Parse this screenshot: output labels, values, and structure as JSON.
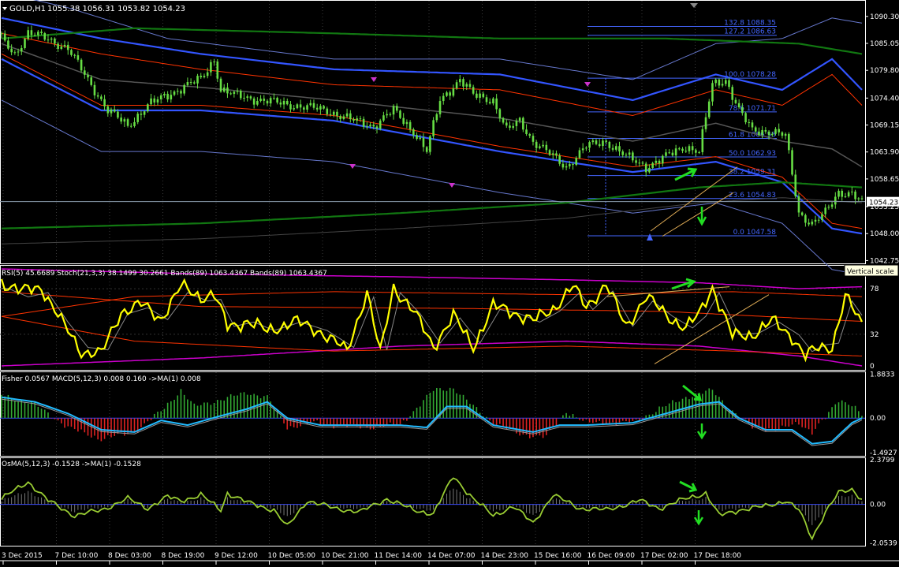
{
  "window": {
    "title": "GOLD,H1",
    "ohlc": "1055.38 1056.31 1053.82 1054.23",
    "vertical_scale_tooltip": "Vertical scale"
  },
  "colors": {
    "background": "#000000",
    "axis": "#ffffff",
    "grid": "#3a3a3a",
    "price": "#66dd44",
    "bollinger_outer": "#3355ff",
    "bollinger_inner": "#6677cc",
    "bands_red": "#ff3300",
    "bands_green": "#117711",
    "fibonacci": "#4466ff",
    "rsi": "#ffff00",
    "stoch": "#888888",
    "stoch_bands": "#cc00cc",
    "stoch_red": "#ff3300",
    "fisher_pos": "#33aa33",
    "fisher_neg": "#dd2222",
    "macd": "#22bbff",
    "macd_signal": "#999999",
    "osma": "#99cc33",
    "zero_line": "#3344ff",
    "arrow": "#22dd22",
    "trend": "#ddaa55"
  },
  "chart_data": [
    {
      "type": "line",
      "title": "GOLD,H1",
      "ohlc_last": {
        "open": 1055.38,
        "high": 1056.31,
        "low": 1053.82,
        "close": 1054.23
      },
      "current_price": 1054.23,
      "y_axis_ticks": [
        1090.3,
        1085.05,
        1079.8,
        1074.4,
        1069.15,
        1063.9,
        1058.65,
        1053.25,
        1048.0,
        1042.75
      ],
      "ylim": [
        1042.2,
        1093.5
      ],
      "x_axis_ticks": [
        "3 Dec 2015",
        "7 Dec 10:00",
        "8 Dec 03:00",
        "8 Dec 19:00",
        "9 Dec 12:00",
        "10 Dec 05:00",
        "10 Dec 21:00",
        "11 Dec 14:00",
        "14 Dec 07:00",
        "14 Dec 23:00",
        "15 Dec 16:00",
        "16 Dec 09:00",
        "17 Dec 02:00",
        "17 Dec 18:00"
      ],
      "bar_count": 260,
      "close_keypoints": [
        [
          0,
          1086
        ],
        [
          4,
          1083
        ],
        [
          8,
          1087
        ],
        [
          14,
          1086
        ],
        [
          20,
          1084
        ],
        [
          26,
          1078
        ],
        [
          32,
          1072
        ],
        [
          38,
          1069
        ],
        [
          44,
          1073
        ],
        [
          50,
          1075
        ],
        [
          56,
          1077
        ],
        [
          60,
          1078
        ],
        [
          64,
          1082
        ],
        [
          66,
          1076
        ],
        [
          70,
          1075
        ],
        [
          78,
          1074
        ],
        [
          88,
          1073
        ],
        [
          98,
          1072
        ],
        [
          106,
          1070
        ],
        [
          112,
          1069
        ],
        [
          118,
          1072
        ],
        [
          124,
          1068
        ],
        [
          128,
          1064
        ],
        [
          132,
          1074
        ],
        [
          138,
          1078
        ],
        [
          142,
          1075
        ],
        [
          148,
          1074
        ],
        [
          152,
          1068
        ],
        [
          156,
          1070
        ],
        [
          160,
          1066
        ],
        [
          166,
          1063
        ],
        [
          170,
          1061
        ],
        [
          176,
          1065
        ],
        [
          182,
          1066
        ],
        [
          188,
          1063
        ],
        [
          194,
          1061
        ],
        [
          200,
          1063
        ],
        [
          206,
          1065
        ],
        [
          210,
          1064
        ],
        [
          214,
          1077
        ],
        [
          218,
          1078
        ],
        [
          222,
          1072
        ],
        [
          226,
          1068
        ],
        [
          232,
          1068
        ],
        [
          236,
          1067
        ],
        [
          240,
          1052
        ],
        [
          244,
          1050
        ],
        [
          248,
          1052
        ],
        [
          252,
          1056
        ],
        [
          256,
          1056
        ],
        [
          259,
          1054
        ]
      ],
      "bands": {
        "upper_outer_keypoints": [
          [
            0,
            1095
          ],
          [
            20,
            1092
          ],
          [
            50,
            1086
          ],
          [
            100,
            1082
          ],
          [
            150,
            1082
          ],
          [
            190,
            1078
          ],
          [
            215,
            1085
          ],
          [
            235,
            1086
          ],
          [
            250,
            1090
          ],
          [
            259,
            1089
          ]
        ],
        "upper_inner_keypoints": [
          [
            0,
            1090
          ],
          [
            30,
            1086
          ],
          [
            60,
            1083
          ],
          [
            100,
            1080
          ],
          [
            150,
            1079
          ],
          [
            190,
            1074
          ],
          [
            215,
            1079
          ],
          [
            235,
            1076
          ],
          [
            250,
            1082
          ],
          [
            259,
            1076
          ]
        ],
        "lower_inner_keypoints": [
          [
            0,
            1080
          ],
          [
            30,
            1070
          ],
          [
            60,
            1070
          ],
          [
            100,
            1068
          ],
          [
            150,
            1062
          ],
          [
            190,
            1058
          ],
          [
            215,
            1060
          ],
          [
            235,
            1056
          ],
          [
            250,
            1047
          ],
          [
            259,
            1046
          ]
        ],
        "green_upper_keypoints": [
          [
            0,
            1086
          ],
          [
            40,
            1088
          ],
          [
            100,
            1087
          ],
          [
            150,
            1086
          ],
          [
            200,
            1086
          ],
          [
            240,
            1085
          ],
          [
            259,
            1083
          ]
        ],
        "green_lower_keypoints": [
          [
            0,
            1049
          ],
          [
            60,
            1050
          ],
          [
            120,
            1052
          ],
          [
            170,
            1054
          ],
          [
            210,
            1057
          ],
          [
            235,
            1058
          ],
          [
            259,
            1057
          ]
        ]
      },
      "fibonacci": [
        {
          "label": "132.8 1088.35",
          "price": 1088.35
        },
        {
          "label": "127.2 1086.63",
          "price": 1086.63
        },
        {
          "label": "100.0 1078.28",
          "price": 1078.28
        },
        {
          "label": "78.6 1071.71",
          "price": 1071.71
        },
        {
          "label": "61.8 1066.55",
          "price": 1066.55
        },
        {
          "label": "50.0 1062.93",
          "price": 1062.93
        },
        {
          "label": "38.2 1059.31",
          "price": 1059.31
        },
        {
          "label": "23.6 1054.83",
          "price": 1054.83
        },
        {
          "label": "0.0 1047.58",
          "price": 1047.58
        }
      ]
    },
    {
      "type": "line",
      "label": "RSI(5) 45.6689  Stoch(21,3,3) 38.1499 30.2661  Bands(89) 1063.4367  Bands(89) 1063.4367",
      "y_axis_ticks": [
        78,
        32,
        0
      ],
      "ylim": [
        -4,
        102
      ],
      "rsi_keypoints": [
        [
          0,
          85
        ],
        [
          6,
          75
        ],
        [
          12,
          80
        ],
        [
          18,
          45
        ],
        [
          24,
          15
        ],
        [
          30,
          12
        ],
        [
          36,
          55
        ],
        [
          42,
          62
        ],
        [
          48,
          48
        ],
        [
          54,
          80
        ],
        [
          60,
          70
        ],
        [
          64,
          72
        ],
        [
          68,
          40
        ],
        [
          74,
          45
        ],
        [
          80,
          35
        ],
        [
          88,
          45
        ],
        [
          96,
          35
        ],
        [
          104,
          15
        ],
        [
          110,
          75
        ],
        [
          114,
          12
        ],
        [
          118,
          80
        ],
        [
          124,
          55
        ],
        [
          130,
          20
        ],
        [
          136,
          50
        ],
        [
          142,
          20
        ],
        [
          148,
          60
        ],
        [
          154,
          55
        ],
        [
          160,
          45
        ],
        [
          166,
          58
        ],
        [
          172,
          80
        ],
        [
          176,
          60
        ],
        [
          182,
          82
        ],
        [
          188,
          40
        ],
        [
          194,
          70
        ],
        [
          200,
          52
        ],
        [
          206,
          38
        ],
        [
          210,
          52
        ],
        [
          214,
          80
        ],
        [
          220,
          30
        ],
        [
          226,
          32
        ],
        [
          232,
          45
        ],
        [
          238,
          30
        ],
        [
          242,
          10
        ],
        [
          246,
          18
        ],
        [
          250,
          20
        ],
        [
          254,
          70
        ],
        [
          259,
          42
        ]
      ]
    },
    {
      "type": "bar",
      "label": "Fisher 0.0567  MACD(5,12,3) 0.008 0.160  ->MA(1) 0.008",
      "y_axis_ticks": [
        1.8833,
        0.0,
        -1.4927
      ],
      "ylim": [
        -1.62,
        2.01
      ],
      "histogram_keypoints": [
        [
          0,
          1.0
        ],
        [
          10,
          0.6
        ],
        [
          20,
          -0.4
        ],
        [
          30,
          -0.9
        ],
        [
          40,
          -0.6
        ],
        [
          48,
          0.3
        ],
        [
          54,
          1.2
        ],
        [
          58,
          0.5
        ],
        [
          66,
          0.8
        ],
        [
          74,
          1.1
        ],
        [
          80,
          0.9
        ],
        [
          86,
          -0.4
        ],
        [
          94,
          -0.2
        ],
        [
          100,
          -0.3
        ],
        [
          110,
          -0.4
        ],
        [
          120,
          -0.3
        ],
        [
          130,
          1.2
        ],
        [
          136,
          1.3
        ],
        [
          142,
          0.5
        ],
        [
          148,
          -0.2
        ],
        [
          156,
          -0.7
        ],
        [
          164,
          -0.8
        ],
        [
          170,
          0.3
        ],
        [
          176,
          -0.2
        ],
        [
          182,
          -0.2
        ],
        [
          190,
          -0.2
        ],
        [
          198,
          0.4
        ],
        [
          206,
          0.9
        ],
        [
          214,
          1.2
        ],
        [
          220,
          0.3
        ],
        [
          226,
          -0.4
        ],
        [
          234,
          -0.5
        ],
        [
          240,
          -0.2
        ],
        [
          244,
          -0.6
        ],
        [
          248,
          0.0
        ],
        [
          252,
          0.8
        ],
        [
          256,
          0.6
        ],
        [
          259,
          0.1
        ]
      ],
      "macd_keypoints": [
        [
          0,
          0.9
        ],
        [
          10,
          0.7
        ],
        [
          20,
          0.2
        ],
        [
          30,
          -0.5
        ],
        [
          40,
          -0.6
        ],
        [
          48,
          -0.1
        ],
        [
          56,
          -0.3
        ],
        [
          66,
          0.1
        ],
        [
          74,
          0.4
        ],
        [
          80,
          0.7
        ],
        [
          86,
          0.0
        ],
        [
          96,
          -0.3
        ],
        [
          110,
          -0.3
        ],
        [
          120,
          -0.3
        ],
        [
          128,
          -0.4
        ],
        [
          134,
          0.5
        ],
        [
          140,
          0.5
        ],
        [
          148,
          -0.3
        ],
        [
          160,
          -0.6
        ],
        [
          168,
          -0.3
        ],
        [
          176,
          -0.3
        ],
        [
          190,
          -0.2
        ],
        [
          200,
          0.2
        ],
        [
          210,
          0.6
        ],
        [
          216,
          0.7
        ],
        [
          222,
          0.0
        ],
        [
          230,
          -0.5
        ],
        [
          238,
          -0.5
        ],
        [
          244,
          -1.1
        ],
        [
          250,
          -1.0
        ],
        [
          256,
          -0.2
        ],
        [
          259,
          0.0
        ]
      ]
    },
    {
      "type": "bar",
      "label": "OsMA(5,12,3) -0.1528  ->MA(1) -0.1528",
      "y_axis_ticks": [
        2.3799,
        0.0,
        -2.0539
      ],
      "ylim": [
        -2.2,
        2.5
      ],
      "osma_keypoints": [
        [
          0,
          0.3
        ],
        [
          8,
          1.2
        ],
        [
          14,
          0.2
        ],
        [
          22,
          -0.6
        ],
        [
          30,
          -0.3
        ],
        [
          38,
          0.3
        ],
        [
          44,
          -0.2
        ],
        [
          50,
          0.4
        ],
        [
          54,
          0.2
        ],
        [
          60,
          0.5
        ],
        [
          66,
          -0.3
        ],
        [
          68,
          0.6
        ],
        [
          74,
          0.1
        ],
        [
          82,
          -0.3
        ],
        [
          86,
          -1.2
        ],
        [
          92,
          0.2
        ],
        [
          100,
          -0.2
        ],
        [
          108,
          -0.4
        ],
        [
          116,
          0.3
        ],
        [
          124,
          -0.3
        ],
        [
          130,
          -0.5
        ],
        [
          136,
          1.5
        ],
        [
          142,
          0.3
        ],
        [
          148,
          -0.6
        ],
        [
          154,
          -0.1
        ],
        [
          160,
          -1.0
        ],
        [
          166,
          0.5
        ],
        [
          174,
          -0.2
        ],
        [
          182,
          -0.3
        ],
        [
          192,
          0.2
        ],
        [
          198,
          -0.2
        ],
        [
          206,
          0.3
        ],
        [
          212,
          0.6
        ],
        [
          216,
          -0.6
        ],
        [
          222,
          -0.3
        ],
        [
          230,
          -0.1
        ],
        [
          236,
          0.2
        ],
        [
          240,
          -0.3
        ],
        [
          244,
          -1.8
        ],
        [
          248,
          -0.4
        ],
        [
          252,
          0.6
        ],
        [
          256,
          0.8
        ],
        [
          259,
          0.3
        ]
      ]
    }
  ]
}
